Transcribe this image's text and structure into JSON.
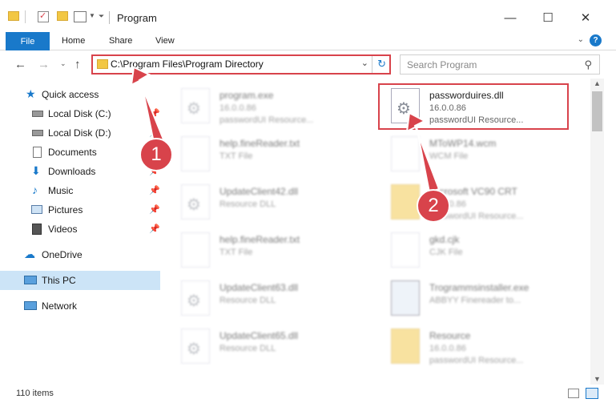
{
  "window": {
    "title": "Program",
    "minimize_glyph": "—",
    "maximize_glyph": "☐",
    "close_glyph": "✕"
  },
  "ribbon": {
    "file": "File",
    "home": "Home",
    "share": "Share",
    "view": "View",
    "help_glyph": "?"
  },
  "address": {
    "path": "C:\\Program Files\\Program Directory"
  },
  "search": {
    "placeholder": "Search Program"
  },
  "nav": {
    "items": [
      {
        "label": "Quick access",
        "icon": "star-icon",
        "pinned": false
      },
      {
        "label": "Local Disk (C:)",
        "icon": "drive-icon",
        "pinned": true
      },
      {
        "label": "Local Disk (D:)",
        "icon": "drive-icon",
        "pinned": true
      },
      {
        "label": "Documents",
        "icon": "document-icon",
        "pinned": true
      },
      {
        "label": "Downloads",
        "icon": "download-icon",
        "pinned": true
      },
      {
        "label": "Music",
        "icon": "music-icon",
        "pinned": true
      },
      {
        "label": "Pictures",
        "icon": "picture-icon",
        "pinned": true
      },
      {
        "label": "Videos",
        "icon": "video-icon",
        "pinned": true
      },
      {
        "label": "OneDrive",
        "icon": "cloud-icon",
        "pinned": false
      },
      {
        "label": "This PC",
        "icon": "computer-icon",
        "pinned": false
      },
      {
        "label": "Network",
        "icon": "network-icon",
        "pinned": false
      }
    ]
  },
  "files": [
    {
      "name": "program.exe",
      "sub1": "16.0.0.86",
      "sub2": "passwordUI Resource..."
    },
    {
      "name": "passworduires.dll",
      "sub1": "16.0.0.86",
      "sub2": "passwordUI Resource..."
    },
    {
      "name": "help.fineReader.txt",
      "sub1": "TXT File",
      "sub2": ""
    },
    {
      "name": "MToWP14.wcm",
      "sub1": "WCM File",
      "sub2": ""
    },
    {
      "name": "UpdateClient42.dll",
      "sub1": "Resource DLL",
      "sub2": ""
    },
    {
      "name": "Microsoft VC90 CRT",
      "sub1": "16.0.0.86",
      "sub2": "passwordUI Resource..."
    },
    {
      "name": "help.fineReader.txt",
      "sub1": "TXT File",
      "sub2": ""
    },
    {
      "name": "gkd.cjk",
      "sub1": "CJK File",
      "sub2": ""
    },
    {
      "name": "UpdateClient63.dll",
      "sub1": "Resource DLL",
      "sub2": ""
    },
    {
      "name": "Trogrammsinstaller.exe",
      "sub1": "ABBYY Finereader to...",
      "sub2": ""
    },
    {
      "name": "UpdateClient65.dll",
      "sub1": "Resource DLL",
      "sub2": ""
    },
    {
      "name": "Resource",
      "sub1": "16.0.0.86",
      "sub2": "passwordUI Resource..."
    }
  ],
  "status": {
    "item_count": "110 items"
  },
  "annotations": {
    "badge1": "1",
    "badge2": "2",
    "accent_color": "#d8434b"
  },
  "colors": {
    "file_tab": "#1979ca",
    "selection": "#cce4f7"
  }
}
